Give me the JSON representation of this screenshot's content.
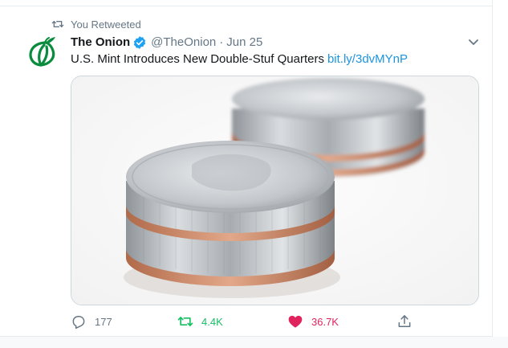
{
  "retweet_context": {
    "label": "You Retweeted",
    "icon": "retweet-icon"
  },
  "tweet": {
    "author": {
      "display_name": "The Onion",
      "handle": "@TheOnion",
      "verified": true,
      "avatar_icon": "onion-logo"
    },
    "separator": "·",
    "date": "Jun 25",
    "text": "U.S. Mint Introduces New Double-Stuf Quarters",
    "link": "bit.ly/3dvMYnP",
    "media_description_icon": "stacked-quarters-photo"
  },
  "actions": {
    "reply_count": "177",
    "retweet_count": "4.4K",
    "like_count": "36.7K",
    "colors": {
      "muted": "#657786",
      "retweet_active": "#17bf63",
      "like_active": "#e0245e",
      "link": "#1b95e0",
      "verified": "#1da1f2",
      "brand_green": "#0a8c3e"
    }
  }
}
